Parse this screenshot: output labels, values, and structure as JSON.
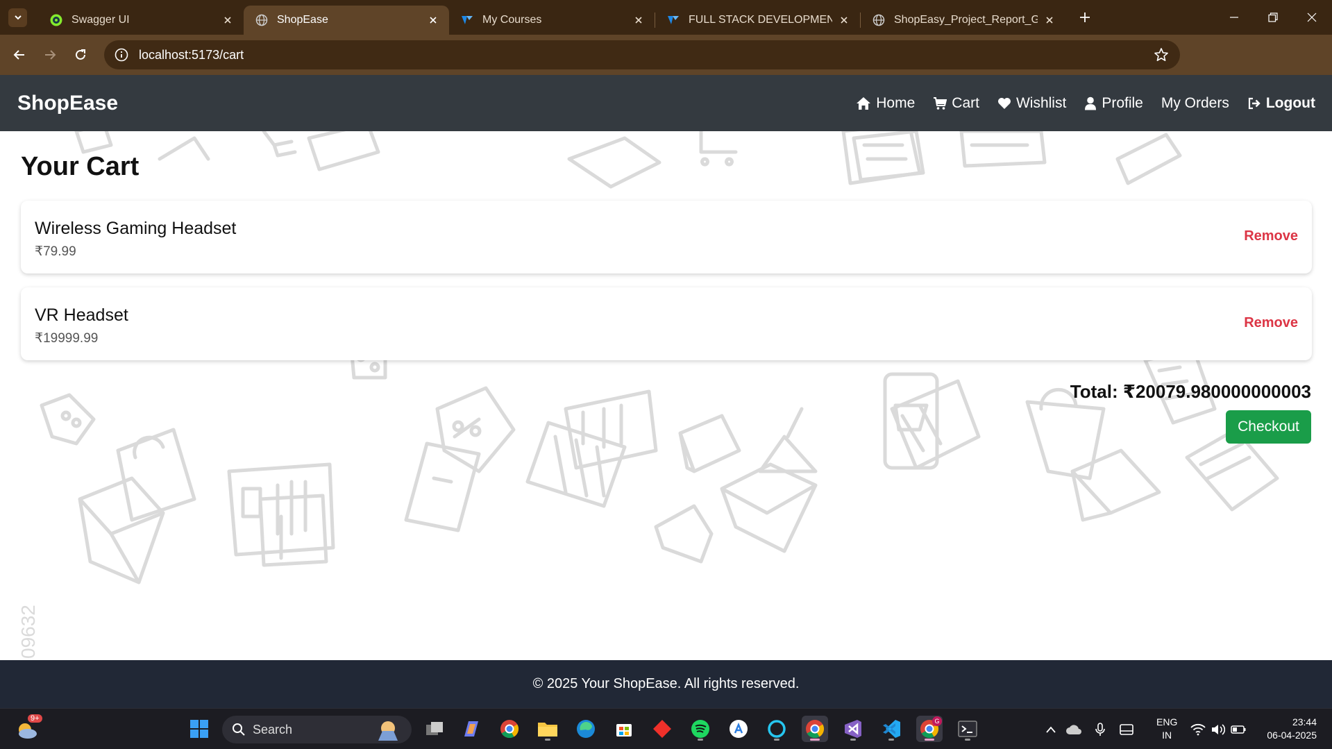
{
  "browser": {
    "tabs": [
      {
        "title": "Swagger UI",
        "active": false
      },
      {
        "title": "ShopEase",
        "active": true
      },
      {
        "title": "My Courses",
        "active": false
      },
      {
        "title": "FULL STACK DEVELOPMENT - C",
        "active": false
      },
      {
        "title": "ShopEasy_Project_Report_GRAC",
        "active": false
      }
    ],
    "url": "localhost:5173/cart",
    "profile_initial": "G"
  },
  "app": {
    "brand": "ShopEase",
    "nav": {
      "home": "Home",
      "cart": "Cart",
      "wishlist": "Wishlist",
      "profile": "Profile",
      "orders": "My Orders",
      "logout": "Logout"
    }
  },
  "cart": {
    "heading": "Your Cart",
    "items": [
      {
        "name": "Wireless Gaming Headset",
        "price": "₹79.99",
        "remove_label": "Remove"
      },
      {
        "name": "VR Headset",
        "price": "₹19999.99",
        "remove_label": "Remove"
      }
    ],
    "total": "Total: ₹20079.980000000003",
    "checkout_label": "Checkout",
    "pattern_text": "09632"
  },
  "footer": {
    "text": "© 2025 Your ShopEase. All rights reserved."
  },
  "taskbar": {
    "search_placeholder": "Search",
    "weather_badge": "9+",
    "language": "ENG",
    "region": "IN",
    "time": "23:44",
    "date": "06-04-2025"
  },
  "colors": {
    "tab_bar": "#3a2612",
    "address_bar": "#5f4428",
    "app_nav": "#343a40",
    "remove": "#dc3545",
    "checkout": "#1a9d49",
    "footer": "#212836"
  }
}
